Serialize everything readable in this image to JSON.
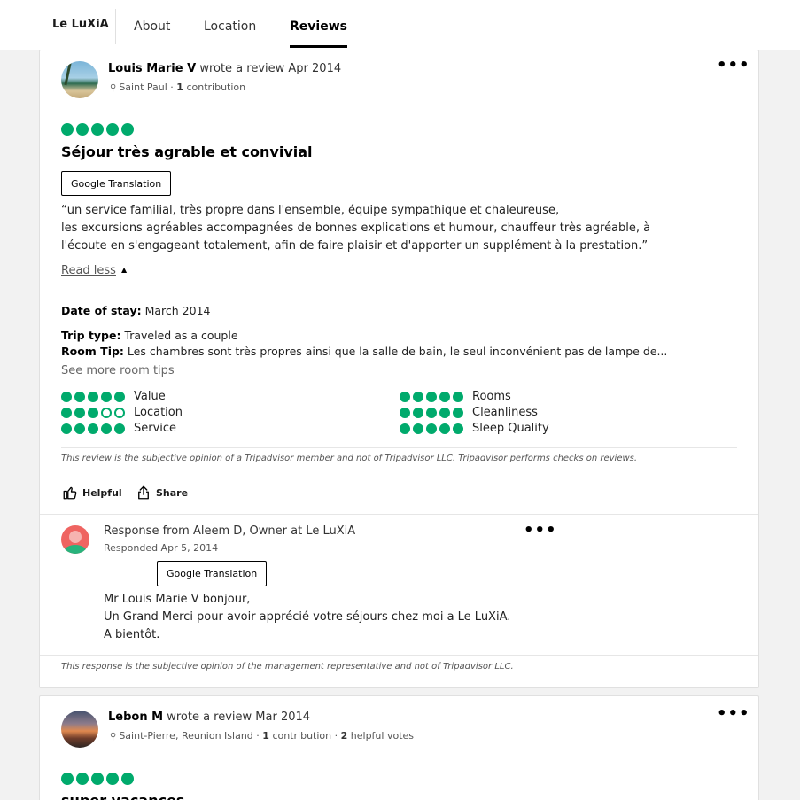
{
  "topbar": {
    "brand": "Le LuXiA",
    "tabs": [
      {
        "label": "About",
        "active": false
      },
      {
        "label": "Location",
        "active": false
      },
      {
        "label": "Reviews",
        "active": true
      }
    ]
  },
  "colors": {
    "bubble_green": "#00aa6c",
    "owner_avatar": "#ef6461"
  },
  "reviews": [
    {
      "author": "Louis Marie V",
      "action_text": "wrote a review Apr 2014",
      "location": "Saint Paul",
      "contribution_count": "1",
      "contribution_label": "contribution",
      "rating": 5,
      "title": "Séjour très agrable et convivial",
      "translate_label": "Google Translation",
      "body_lines": [
        "“un service familial, très propre dans l'ensemble, équipe sympathique et chaleureuse,",
        "les excursions agréables accompagnées de bonnes explications et humour, chauffeur très agréable, à",
        "l'écoute en s'engageant totalement, afin de faire plaisir et d'apporter un supplément à la prestation.”"
      ],
      "read_less_label": "Read less",
      "date_of_stay_label": "Date of stay:",
      "date_of_stay": "March 2014",
      "trip_type_label": "Trip type:",
      "trip_type": "Traveled as a couple",
      "room_tip_label": "Room Tip:",
      "room_tip": "Les chambres sont très propres ainsi que la salle de bain, le seul inconvénient pas de lampe de...",
      "see_more_label": "See more room tips",
      "subratings": [
        {
          "label": "Value",
          "rating": 5
        },
        {
          "label": "Location",
          "rating": 3
        },
        {
          "label": "Service",
          "rating": 5
        },
        {
          "label": "Rooms",
          "rating": 5
        },
        {
          "label": "Cleanliness",
          "rating": 5
        },
        {
          "label": "Sleep Quality",
          "rating": 5
        }
      ],
      "disclaimer": "This review is the subjective opinion of a Tripadvisor member and not of Tripadvisor LLC. Tripadvisor performs checks on reviews.",
      "helpful_label": "Helpful",
      "share_label": "Share",
      "response": {
        "header": "Response from Aleem D, Owner at Le LuXiA",
        "responded": "Responded Apr 5, 2014",
        "translate_label": "Google Translation",
        "body_lines": [
          "Mr Louis Marie V bonjour,",
          "Un Grand Merci pour avoir apprécié votre séjours chez moi a Le LuXiA.",
          "A bientôt."
        ],
        "disclaimer": "This response is the subjective opinion of the management representative and not of Tripadvisor LLC."
      }
    },
    {
      "author": "Lebon M",
      "action_text": "wrote a review Mar 2014",
      "location": "Saint-Pierre, Reunion Island",
      "contribution_count": "1",
      "contribution_label": "contribution",
      "helpful_count": "2",
      "helpful_votes_label": "helpful votes",
      "rating": 5,
      "title": "super vacances"
    }
  ]
}
